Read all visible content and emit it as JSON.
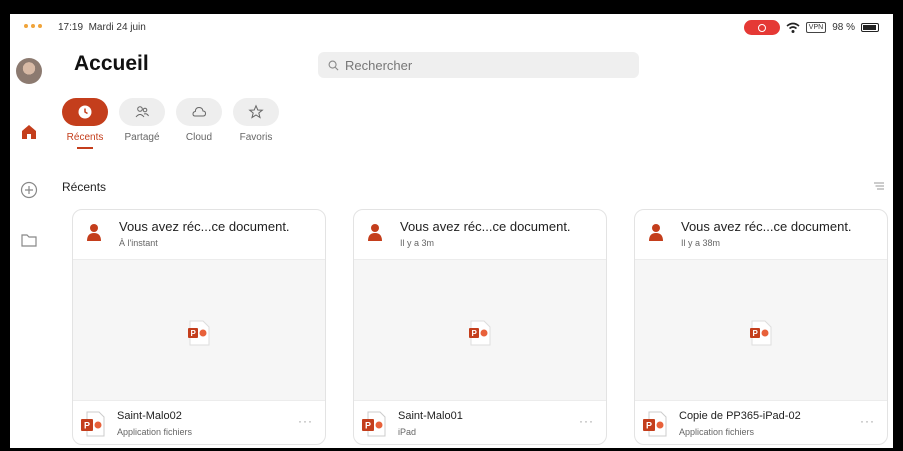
{
  "status_bar": {
    "time": "17:19",
    "date": "Mardi 24 juin",
    "vpn": "VPN",
    "battery": "98 %"
  },
  "header": {
    "title": "Accueil",
    "search_placeholder": "Rechercher"
  },
  "tabs": [
    {
      "label": "Récents",
      "icon": "clock-icon",
      "active": true
    },
    {
      "label": "Partagé",
      "icon": "people-icon",
      "active": false
    },
    {
      "label": "Cloud",
      "icon": "cloud-icon",
      "active": false
    },
    {
      "label": "Favoris",
      "icon": "star-icon",
      "active": false
    }
  ],
  "section": {
    "title": "Récents"
  },
  "cards": [
    {
      "activity": "Vous avez réc...ce document.",
      "time": "À l'instant",
      "file_name": "Saint-Malo02",
      "location": "Application fichiers"
    },
    {
      "activity": "Vous avez réc...ce document.",
      "time": "Il y a 3m",
      "file_name": "Saint-Malo01",
      "location": "iPad"
    },
    {
      "activity": "Vous avez réc...ce document.",
      "time": "Il y a 38m",
      "file_name": "Copie de PP365-iPad-02",
      "location": "Application fichiers"
    }
  ],
  "colors": {
    "accent": "#c43e1c",
    "recording": "#e53935"
  }
}
